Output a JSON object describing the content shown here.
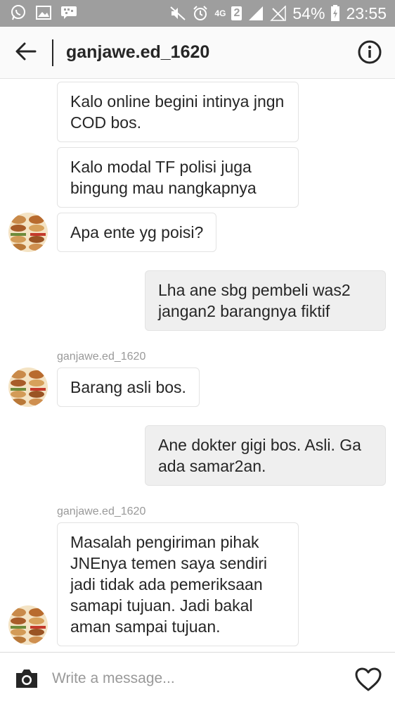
{
  "status_bar": {
    "network_type": "4G",
    "sim_slot": "2",
    "battery": "54%",
    "time": "23:55",
    "left_icons": [
      "whatsapp-icon",
      "gallery-icon",
      "bbm-icon"
    ],
    "right_icons": [
      "mute-icon",
      "alarm-icon",
      "signal-icon",
      "signal-empty-icon",
      "charging-icon"
    ]
  },
  "header": {
    "title": "ganjawe.ed_1620",
    "back_icon": "arrow-left-icon",
    "info_icon": "info-icon"
  },
  "messages": [
    {
      "direction": "in",
      "text": "Kalo online begini intinya jngn COD bos."
    },
    {
      "direction": "in",
      "text": "Kalo modal TF polisi juga bingung mau nangkapnya"
    },
    {
      "direction": "in",
      "text": "Apa ente yg poisi?",
      "avatar": true
    },
    {
      "direction": "out",
      "text": "Lha ane sbg pembeli was2 jangan2 barangnya fiktif"
    },
    {
      "direction": "in",
      "sender": "ganjawe.ed_1620",
      "text": "Barang asli bos.",
      "avatar": true
    },
    {
      "direction": "out",
      "text": "Ane dokter gigi bos. Asli. Ga ada samar2an."
    },
    {
      "direction": "in",
      "sender": "ganjawe.ed_1620",
      "text": "Masalah pengiriman pihak JNEnya temen saya sendiri jadi tidak ada pemeriksaan samapi tujuan. Jadi bakal aman sampai tujuan.",
      "avatar": true
    }
  ],
  "composer": {
    "placeholder": "Write a message...",
    "camera_icon": "camera-icon",
    "heart_icon": "heart-icon"
  },
  "colors": {
    "status_bar": "#9e9e9e",
    "header_bg": "#fafafa",
    "incoming_bubble": "#ffffff",
    "outgoing_bubble": "#efefef",
    "text": "#262626",
    "secondary_text": "#999999"
  }
}
